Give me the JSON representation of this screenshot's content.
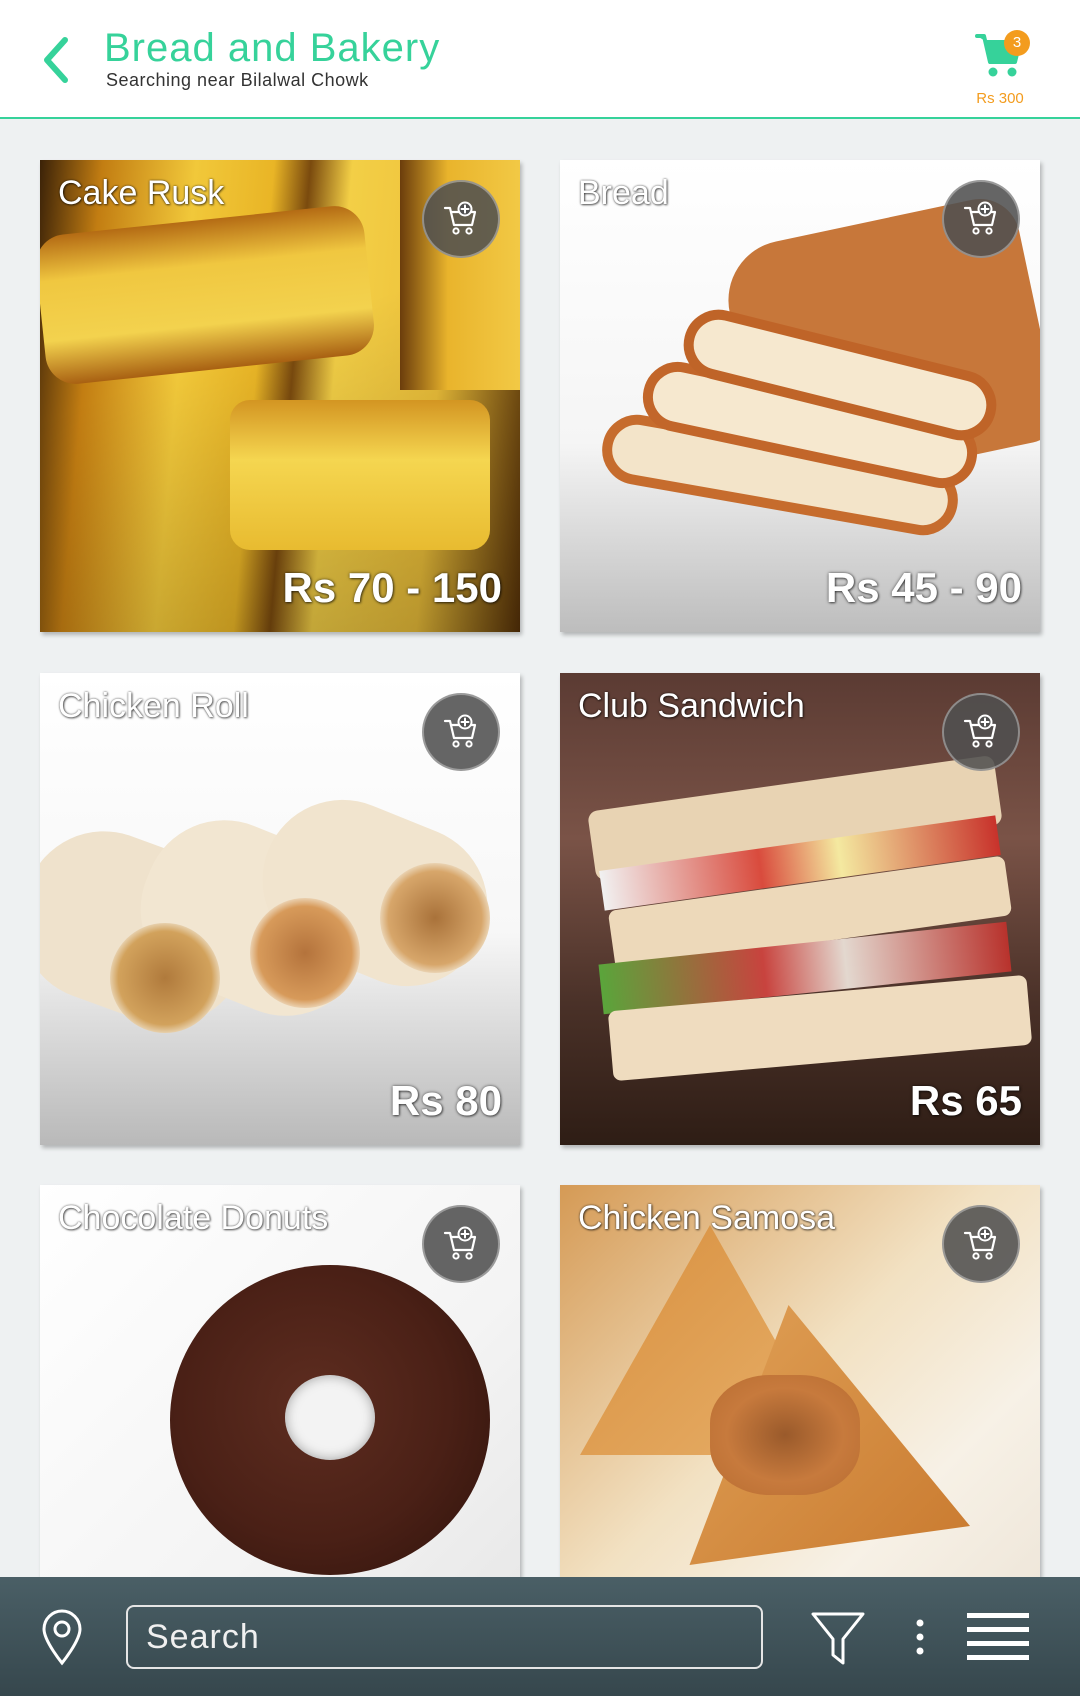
{
  "header": {
    "title": "Bread and Bakery",
    "subtitle": "Searching near Bilalwal Chowk",
    "cart_count": "3",
    "cart_total": "Rs 300"
  },
  "products": [
    {
      "name": "Cake Rusk",
      "price": "Rs 70 - 150"
    },
    {
      "name": "Bread",
      "price": "Rs 45 - 90"
    },
    {
      "name": "Chicken Roll",
      "price": "Rs 80"
    },
    {
      "name": "Club Sandwich",
      "price": "Rs 65"
    },
    {
      "name": "Chocolate Donuts",
      "price": ""
    },
    {
      "name": "Chicken Samosa",
      "price": ""
    }
  ],
  "bottom_bar": {
    "search_placeholder": "Search"
  },
  "colors": {
    "accent": "#36d29a",
    "badge": "#f39c1e",
    "bottom_bar": "#3f5259"
  },
  "icons": [
    "back-arrow-icon",
    "cart-icon",
    "add-to-cart-icon",
    "location-pin-icon",
    "filter-icon",
    "more-vertical-icon",
    "hamburger-menu-icon"
  ]
}
